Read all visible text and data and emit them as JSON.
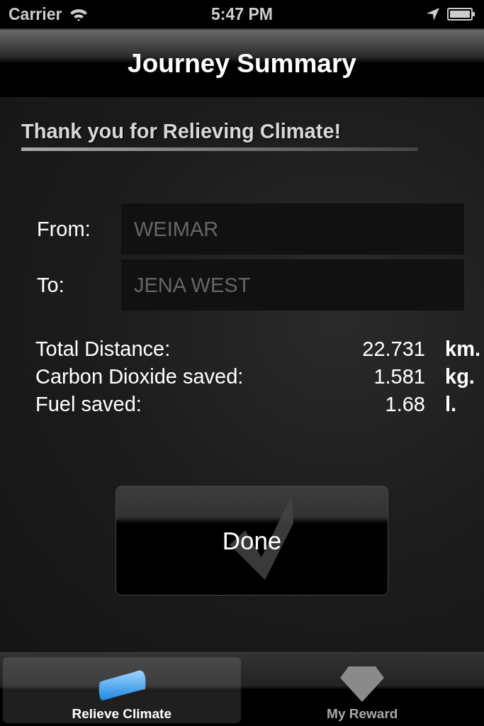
{
  "status_bar": {
    "carrier": "Carrier",
    "time": "5:47 PM"
  },
  "nav_bar": {
    "title": "Journey Summary"
  },
  "heading": "Thank you for Relieving Climate!",
  "fields": [
    {
      "label": "From:",
      "value": "WEIMAR"
    },
    {
      "label": "To:",
      "value": "JENA WEST"
    }
  ],
  "stats": [
    {
      "label": "Total Distance:",
      "value": "22.731",
      "unit": "km."
    },
    {
      "label": "Carbon Dioxide saved:",
      "value": "1.581",
      "unit": "kg."
    },
    {
      "label": "Fuel saved:",
      "value": "1.68",
      "unit": "l."
    }
  ],
  "done_button": {
    "label": "Done"
  },
  "tab_bar": [
    {
      "label": "Relieve Climate",
      "kind": "climate",
      "selected": true
    },
    {
      "label": "My Reward",
      "kind": "reward",
      "selected": false
    }
  ]
}
